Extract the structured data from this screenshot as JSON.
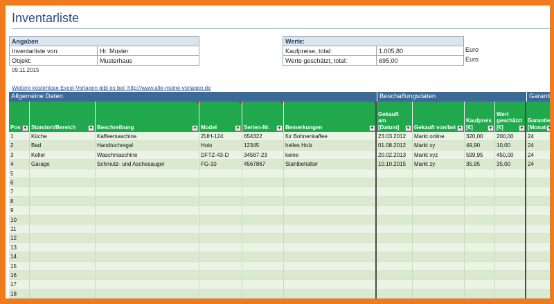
{
  "title": "Inventarliste",
  "angaben": {
    "header": "Angaben",
    "rows": [
      {
        "label": "Inventarliste von:",
        "value": "Hr. Muster"
      },
      {
        "label": "Objekt:",
        "value": "Musterhaus"
      }
    ]
  },
  "werte": {
    "header": "Werte:",
    "rows": [
      {
        "label": "Kaufpreise, total:",
        "value": "1.005,80",
        "unit": "Euro"
      },
      {
        "label": "Werte geschätzt, total:",
        "value": "695,00",
        "unit": "Euro"
      }
    ]
  },
  "date": "09.11.2015",
  "link": "Weitere kostenlose Excel-Vorlagen gibt es bei: http://www.alle-meine-vorlagen.de",
  "sections": [
    "Allgemeine Daten",
    "Beschaffungsdaten",
    "Garantie"
  ],
  "columns": [
    "Pos",
    "Standort/Bereich",
    "Beschreibung",
    "Model",
    "Serien-Nr.",
    "Bemerkungen",
    "Gekauft am [Datum]",
    "Gekauft von/bei",
    "Kaufpreis [€]",
    "Wert geschätzt [€]",
    "Garantie [Monate]"
  ],
  "rows": [
    [
      "1",
      "Küche",
      "Kaffeemaschine",
      "ZUH-124",
      "654322",
      "für Bohnenkaffee",
      "23.03.2012",
      "Markt online",
      "320,00",
      "200,00",
      "24"
    ],
    [
      "2",
      "Bad",
      "Handtuchregal",
      "Holo",
      "12345",
      "helles Holz",
      "01.08.2012",
      "Markt xy",
      "49,90",
      "10,00",
      "24"
    ],
    [
      "3",
      "Keller",
      "Waschmaschine",
      "DFTZ-43-D",
      "34567-23",
      "keine",
      "20.02.2013",
      "Markt xyz",
      "599,95",
      "450,00",
      "24"
    ],
    [
      "4",
      "Garage",
      "Schmutz- und Aschesauger",
      "FG-10",
      "4567867",
      "Stahlbehälter",
      "10.10.2015",
      "Markt zy",
      "35,95",
      "35,00",
      "24"
    ],
    [
      "5"
    ],
    [
      "6"
    ],
    [
      "7"
    ],
    [
      "8"
    ],
    [
      "9"
    ],
    [
      "10"
    ],
    [
      "11"
    ],
    [
      "12"
    ],
    [
      "13"
    ],
    [
      "14"
    ],
    [
      "15"
    ],
    [
      "16"
    ],
    [
      "17"
    ],
    [
      "18"
    ]
  ],
  "icons": {
    "filter": "filter-dropdown-icon",
    "comment": "comment-indicator-icon"
  }
}
